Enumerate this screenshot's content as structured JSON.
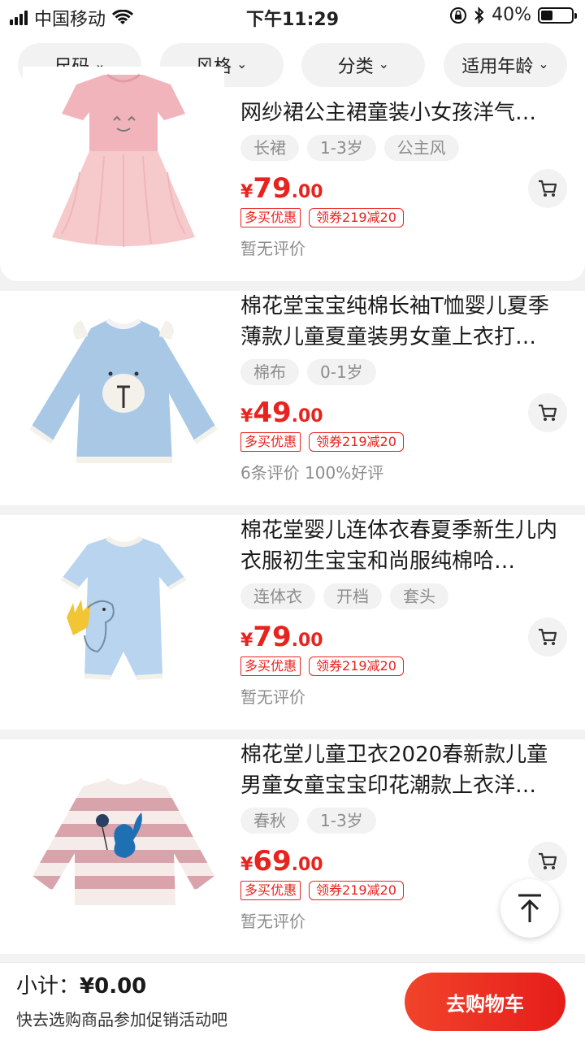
{
  "status_bar": {
    "carrier": "中国移动",
    "time": "下午11:29",
    "battery_text": "40%",
    "battery_level": 0.4
  },
  "filters": [
    {
      "label": "尺码"
    },
    {
      "label": "风格"
    },
    {
      "label": "分类"
    },
    {
      "label": "适用年龄"
    }
  ],
  "products": [
    {
      "title": "网纱裙公主裙童装小女孩洋气…",
      "tags": [
        "长裙",
        "1-3岁",
        "公主风"
      ],
      "price_symbol": "¥",
      "price_int": "79",
      "price_dec": ".00",
      "promo": "多买优惠",
      "coupon": "领券219减20",
      "reviews": "暂无评价",
      "image": "pink-tulle-dress"
    },
    {
      "title": "棉花堂宝宝纯棉长袖T恤婴儿夏季薄款儿童夏童装男女童上衣打…",
      "tags": [
        "棉布",
        "0-1岁"
      ],
      "price_symbol": "¥",
      "price_int": "49",
      "price_dec": ".00",
      "promo": "多买优惠",
      "coupon": "领券219减20",
      "reviews": "6条评价   100%好评",
      "image": "blue-bear-tshirt"
    },
    {
      "title": "棉花堂婴儿连体衣春夏季新生儿内衣服初生宝宝和尚服纯棉哈…",
      "tags": [
        "连体衣",
        "开档",
        "套头"
      ],
      "price_symbol": "¥",
      "price_int": "79",
      "price_dec": ".00",
      "promo": "多买优惠",
      "coupon": "领券219减20",
      "reviews": "暂无评价",
      "image": "blue-dino-romper"
    },
    {
      "title": "棉花堂儿童卫衣2020春新款儿童男童女童宝宝印花潮款上衣洋…",
      "tags": [
        "春秋",
        "1-3岁"
      ],
      "price_symbol": "¥",
      "price_int": "69",
      "price_dec": ".00",
      "promo": "多买优惠",
      "coupon": "领券219减20",
      "reviews": "暂无评价",
      "image": "pink-striped-sweatshirt"
    }
  ],
  "bottom_bar": {
    "subtotal_label": "小计：",
    "subtotal_value": "¥0.00",
    "hint": "快去选购商品参加促销活动吧",
    "checkout_label": "去购物车"
  },
  "colors": {
    "accent": "#e8231f",
    "tag_bg": "#f2f2f2",
    "muted_text": "#8c8c8c"
  }
}
